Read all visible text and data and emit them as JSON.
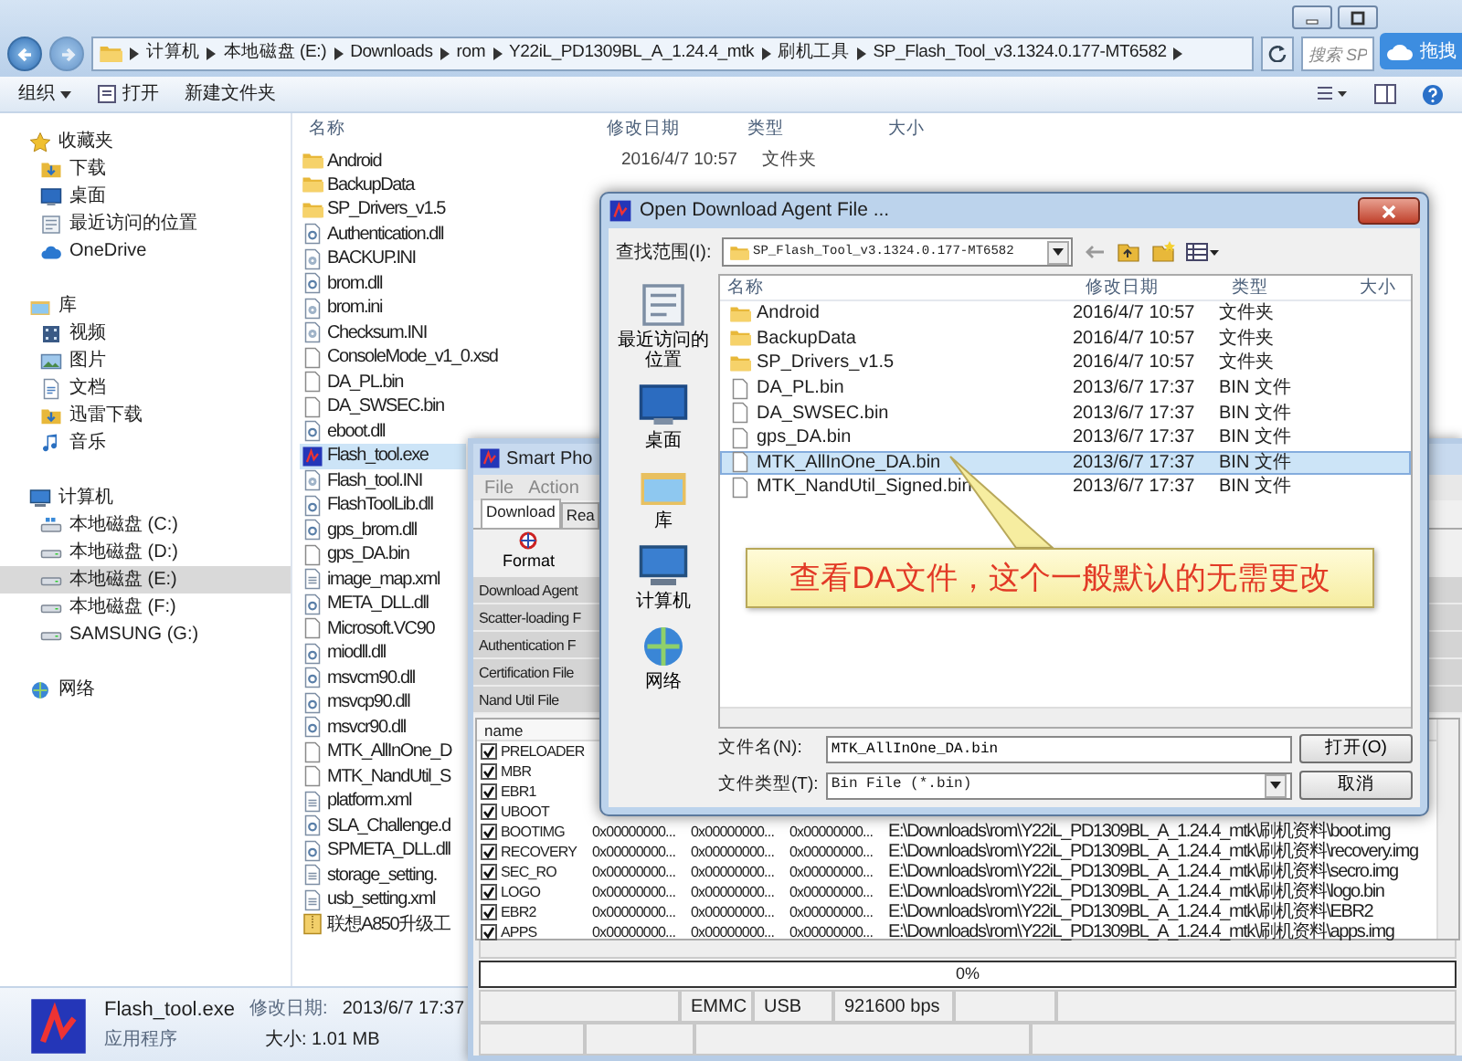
{
  "explorer": {
    "breadcrumb": [
      "计算机",
      "本地磁盘 (E:)",
      "Downloads",
      "rom",
      "Y22iL_PD1309BL_A_1.24.4_mtk",
      "刷机工具",
      "SP_Flash_Tool_v3.1324.0.177-MT6582"
    ],
    "search": {
      "placeholder": "搜索 SP"
    },
    "badge": "拖拽",
    "toolbar": [
      "组织",
      "打开",
      "新建文件夹"
    ],
    "nav": [
      {
        "label": "收藏夹",
        "kind": "star",
        "selected": false,
        "children": [
          {
            "label": "下载",
            "kind": "download",
            "selected": false
          },
          {
            "label": "桌面",
            "kind": "desktop",
            "selected": false
          },
          {
            "label": "最近访问的位置",
            "kind": "recent",
            "selected": false
          },
          {
            "label": "OneDrive",
            "kind": "cloud",
            "selected": false
          }
        ]
      },
      {
        "label": "库",
        "kind": "library",
        "selected": false,
        "children": [
          {
            "label": "视频",
            "kind": "video",
            "selected": false
          },
          {
            "label": "图片",
            "kind": "picture",
            "selected": false
          },
          {
            "label": "文档",
            "kind": "document",
            "selected": false
          },
          {
            "label": "迅雷下载",
            "kind": "download",
            "selected": false
          },
          {
            "label": "音乐",
            "kind": "music",
            "selected": false
          }
        ]
      },
      {
        "label": "计算机",
        "kind": "computer",
        "selected": false,
        "children": [
          {
            "label": "本地磁盘 (C:)",
            "kind": "sysdrive",
            "selected": false
          },
          {
            "label": "本地磁盘 (D:)",
            "kind": "drive",
            "selected": false
          },
          {
            "label": "本地磁盘 (E:)",
            "kind": "drive",
            "selected": true
          },
          {
            "label": "本地磁盘 (F:)",
            "kind": "drive",
            "selected": false
          },
          {
            "label": "SAMSUNG (G:)",
            "kind": "drive",
            "selected": false
          }
        ]
      },
      {
        "label": "网络",
        "kind": "network",
        "selected": false
      }
    ],
    "columns": [
      "名称",
      "修改日期",
      "类型",
      "大小"
    ],
    "files": [
      {
        "name": "Android",
        "kind": "folder",
        "selected": false,
        "date": "2016/4/7 10:57",
        "type": "文件夹"
      },
      {
        "name": "BackupData",
        "kind": "folder",
        "selected": false
      },
      {
        "name": "SP_Drivers_v1.5",
        "kind": "folder",
        "selected": false
      },
      {
        "name": "Authentication.dll",
        "kind": "lib",
        "selected": false
      },
      {
        "name": "BACKUP.INI",
        "kind": "settings",
        "selected": false
      },
      {
        "name": "brom.dll",
        "kind": "lib",
        "selected": false
      },
      {
        "name": "brom.ini",
        "kind": "settings",
        "selected": false
      },
      {
        "name": "Checksum.INI",
        "kind": "settings",
        "selected": false
      },
      {
        "name": "ConsoleMode_v1_0.xsd",
        "kind": "blank",
        "selected": false
      },
      {
        "name": "DA_PL.bin",
        "kind": "blank",
        "selected": false
      },
      {
        "name": "DA_SWSEC.bin",
        "kind": "blank",
        "selected": false
      },
      {
        "name": "eboot.dll",
        "kind": "lib",
        "selected": false
      },
      {
        "name": "Flash_tool.exe",
        "kind": "app",
        "selected": true
      },
      {
        "name": "Flash_tool.INI",
        "kind": "settings",
        "selected": false
      },
      {
        "name": "FlashToolLib.dll",
        "kind": "lib",
        "selected": false
      },
      {
        "name": "gps_brom.dll",
        "kind": "lib",
        "selected": false
      },
      {
        "name": "gps_DA.bin",
        "kind": "blank",
        "selected": false
      },
      {
        "name": "image_map.xml",
        "kind": "xml",
        "selected": false
      },
      {
        "name": "META_DLL.dll",
        "kind": "lib",
        "selected": false
      },
      {
        "name": "Microsoft.VC90",
        "kind": "blank",
        "selected": false
      },
      {
        "name": "miodll.dll",
        "kind": "lib",
        "selected": false
      },
      {
        "name": "msvcm90.dll",
        "kind": "lib",
        "selected": false
      },
      {
        "name": "msvcp90.dll",
        "kind": "lib",
        "selected": false
      },
      {
        "name": "msvcr90.dll",
        "kind": "lib",
        "selected": false
      },
      {
        "name": "MTK_AllInOne_D",
        "kind": "blank",
        "selected": false
      },
      {
        "name": "MTK_NandUtil_S",
        "kind": "blank",
        "selected": false
      },
      {
        "name": "platform.xml",
        "kind": "xml",
        "selected": false
      },
      {
        "name": "SLA_Challenge.d",
        "kind": "lib",
        "selected": false
      },
      {
        "name": "SPMETA_DLL.dll",
        "kind": "lib",
        "selected": false
      },
      {
        "name": "storage_setting.",
        "kind": "xml",
        "selected": false
      },
      {
        "name": "usb_setting.xml",
        "kind": "xml",
        "selected": false
      },
      {
        "name": "联想A850升级工",
        "kind": "archive",
        "selected": false
      }
    ],
    "details": {
      "name": "Flash_tool.exe",
      "date_label": "修改日期:",
      "date": "2013/6/7 17:37",
      "type": "应用程序",
      "size": "大小: 1.01 MB"
    }
  },
  "flash_tool": {
    "title": "Smart Pho",
    "menu": [
      "File",
      "Action"
    ],
    "tabs": [
      {
        "label": "Download",
        "selected": true
      },
      {
        "label": "Rea",
        "selected": false
      }
    ],
    "format_button": "Format",
    "file_labels": [
      "Download Agent",
      "Scatter-loading F",
      "Authentication F",
      "Certification File",
      "Nand Util File"
    ],
    "table": {
      "columns": [
        "name"
      ],
      "rows": [
        {
          "name": "PRELOADER",
          "checked": true
        },
        {
          "name": "MBR",
          "checked": true
        },
        {
          "name": "EBR1",
          "checked": true
        },
        {
          "name": "UBOOT",
          "checked": true
        },
        {
          "name": "BOOTIMG",
          "checked": true,
          "column_2": "0x00000000...",
          "column_3": "0x00000000...",
          "column_4": "0x00000000...",
          "column_5": "E:\\Downloads\\rom\\Y22iL_PD1309BL_A_1.24.4_mtk\\刷机资料\\boot.img"
        },
        {
          "name": "RECOVERY",
          "checked": true,
          "column_2": "0x00000000...",
          "column_3": "0x00000000...",
          "column_4": "0x00000000...",
          "column_5": "E:\\Downloads\\rom\\Y22iL_PD1309BL_A_1.24.4_mtk\\刷机资料\\recovery.img"
        },
        {
          "name": "SEC_RO",
          "checked": true,
          "column_2": "0x00000000...",
          "column_3": "0x00000000...",
          "column_4": "0x00000000...",
          "column_5": "E:\\Downloads\\rom\\Y22iL_PD1309BL_A_1.24.4_mtk\\刷机资料\\secro.img"
        },
        {
          "name": "LOGO",
          "checked": true,
          "column_2": "0x00000000...",
          "column_3": "0x00000000...",
          "column_4": "0x00000000...",
          "column_5": "E:\\Downloads\\rom\\Y22iL_PD1309BL_A_1.24.4_mtk\\刷机资料\\logo.bin"
        },
        {
          "name": "EBR2",
          "checked": true,
          "column_2": "0x00000000...",
          "column_3": "0x00000000...",
          "column_4": "0x00000000...",
          "column_5": "E:\\Downloads\\rom\\Y22iL_PD1309BL_A_1.24.4_mtk\\刷机资料\\EBR2"
        },
        {
          "name": "APPS",
          "checked": true,
          "column_2": "0x00000000...",
          "column_3": "0x00000000...",
          "column_4": "0x00000000...",
          "column_5": "E:\\Downloads\\rom\\Y22iL_PD1309BL_A_1.24.4_mtk\\刷机资料\\apps.img"
        }
      ]
    },
    "progress": {
      "level": 0,
      "reading": "0%"
    },
    "status_bar": [
      "EMMC",
      "USB",
      "921600 bps"
    ]
  },
  "dialog": {
    "title": "Open Download Agent File ...",
    "look_in_label": "查找范围(I):",
    "look_in": "SP_Flash_Tool_v3.1324.0.177-MT6582",
    "places": [
      {
        "label": "最近访问的位置",
        "kind": "recent"
      },
      {
        "label": "桌面",
        "kind": "desktop"
      },
      {
        "label": "库",
        "kind": "library"
      },
      {
        "label": "计算机",
        "kind": "computer"
      },
      {
        "label": "网络",
        "kind": "network"
      }
    ],
    "columns": [
      "名称",
      "修改日期",
      "类型",
      "大小"
    ],
    "files": [
      {
        "name": "Android",
        "kind": "folder",
        "date": "2016/4/7 10:57",
        "type": "文件夹",
        "selected": false
      },
      {
        "name": "BackupData",
        "kind": "folder",
        "date": "2016/4/7 10:57",
        "type": "文件夹",
        "selected": false
      },
      {
        "name": "SP_Drivers_v1.5",
        "kind": "folder",
        "date": "2016/4/7 10:57",
        "type": "文件夹",
        "selected": false
      },
      {
        "name": "DA_PL.bin",
        "kind": "blank",
        "date": "2013/6/7 17:37",
        "type": "BIN 文件",
        "selected": false
      },
      {
        "name": "DA_SWSEC.bin",
        "kind": "blank",
        "date": "2013/6/7 17:37",
        "type": "BIN 文件",
        "selected": false
      },
      {
        "name": "gps_DA.bin",
        "kind": "blank",
        "date": "2013/6/7 17:37",
        "type": "BIN 文件",
        "selected": false
      },
      {
        "name": "MTK_AllInOne_DA.bin",
        "kind": "blank",
        "date": "2013/6/7 17:37",
        "type": "BIN 文件",
        "selected": true
      },
      {
        "name": "MTK_NandUtil_Signed.bin",
        "kind": "blank",
        "date": "2013/6/7 17:37",
        "type": "BIN 文件",
        "selected": false
      }
    ],
    "file_name_label": "文件名(N):",
    "file_name": "MTK_AllInOne_DA.bin",
    "file_type_label": "文件类型(T):",
    "file_type": "Bin File (*.bin)",
    "buttons": [
      "打开(O)",
      "取消"
    ]
  },
  "callout": {
    "text": "查看DA文件，这个一般默认的无需更改"
  }
}
